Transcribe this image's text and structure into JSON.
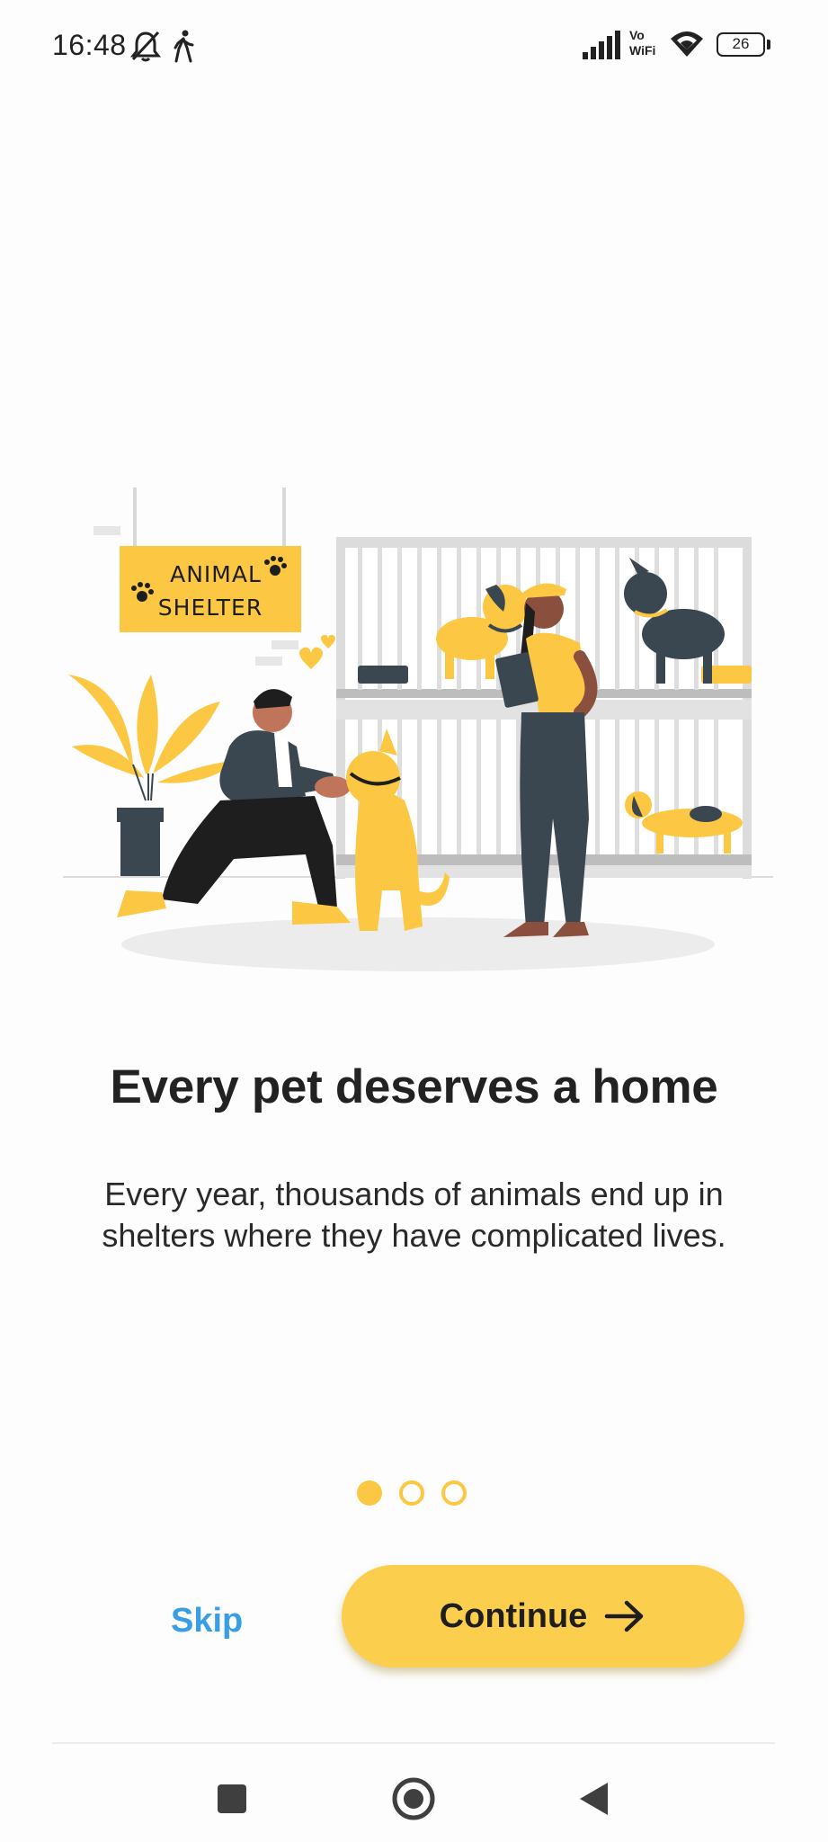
{
  "status_bar": {
    "time": "16:48",
    "icons": [
      "bell-off-icon",
      "walking-icon",
      "signal-icon",
      "wifi-icon"
    ],
    "network_label": "Vo\nWiFi",
    "battery_level": "26"
  },
  "illustration": {
    "sign_line1": "ANIMAL",
    "sign_line2": "SHELTER"
  },
  "onboarding": {
    "title": "Every pet deserves a home",
    "subtitle": "Every year, thousands of animals end up in shelters where they have complicated lives.",
    "page_count": 3,
    "current_page": 1
  },
  "actions": {
    "skip_label": "Skip",
    "continue_label": "Continue"
  },
  "colors": {
    "accent": "#fcc843",
    "button": "#fcce4e",
    "link": "#3a9ee6",
    "dark": "#3a4650"
  },
  "nav_bar": {
    "buttons": [
      "recents-icon",
      "home-icon",
      "back-icon"
    ]
  }
}
